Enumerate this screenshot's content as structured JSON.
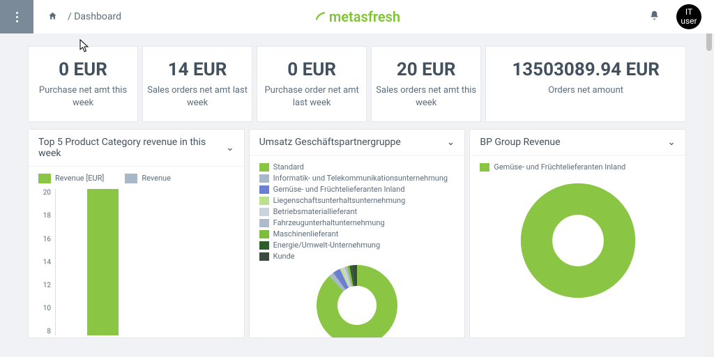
{
  "header": {
    "breadcrumb": "/ Dashboard",
    "brand": "metasfresh",
    "avatar": "IT\nuser"
  },
  "stats": [
    {
      "value": "0 EUR",
      "label": "Purchase net amt this week"
    },
    {
      "value": "14 EUR",
      "label": "Sales orders net amt last week"
    },
    {
      "value": "0 EUR",
      "label": "Purchase order net amt last week"
    },
    {
      "value": "20 EUR",
      "label": "Sales orders net amt this week"
    },
    {
      "value": "13503089.94 EUR",
      "label": "Orders net amount"
    }
  ],
  "panels": {
    "top5": {
      "title": "Top 5 Product Category revenue in this week",
      "legend1": "Revenue [EUR]",
      "legend2": "Revenue"
    },
    "umsatz": {
      "title": "Umsatz Geschäftspartnergruppe"
    },
    "bpgroup": {
      "title": "BP Group Revenue",
      "legend": "Gemüse- und Früchtelieferanten Inland"
    }
  },
  "pie_legend": [
    {
      "label": "Standard",
      "color": "#8ac644"
    },
    {
      "label": "Informatik- und Telekommunikationsunternehmung",
      "color": "#a9b8c7"
    },
    {
      "label": "Gemüse- und Früchtelieferanten Inland",
      "color": "#6b7fd0"
    },
    {
      "label": "Liegenschaftsunterhaltsunternehmung",
      "color": "#bde08e"
    },
    {
      "label": "Betriebsmateriallieferant",
      "color": "#c9d3de"
    },
    {
      "label": "Fahrzeugunterhaltunternehmung",
      "color": "#b0bcc9"
    },
    {
      "label": "Maschinenlieferant",
      "color": "#7ebd3b"
    },
    {
      "label": "Energie/Umwelt-Unternehmung",
      "color": "#2d5d2a"
    },
    {
      "label": "Kunde",
      "color": "#3a4a3d"
    }
  ],
  "chart_data": [
    {
      "type": "bar",
      "title": "Top 5 Product Category revenue in this week",
      "ylabel": "Revenue [EUR]",
      "ylim": [
        6,
        20
      ],
      "yticks": [
        20,
        18,
        16,
        14,
        12,
        10,
        8
      ],
      "categories": [
        ""
      ],
      "series": [
        {
          "name": "Revenue [EUR]",
          "color": "#8ac644",
          "values": [
            20
          ]
        },
        {
          "name": "Revenue",
          "color": "#a9b8c7",
          "values": [
            null
          ]
        }
      ]
    },
    {
      "type": "pie",
      "title": "Umsatz Geschäftspartnergruppe",
      "series": [
        {
          "name": "Standard",
          "value": 88,
          "color": "#8ac644"
        },
        {
          "name": "Informatik- und Telekommunikationsunternehmung",
          "value": 2,
          "color": "#a9b8c7"
        },
        {
          "name": "Gemüse- und Früchtelieferanten Inland",
          "value": 3,
          "color": "#6b7fd0"
        },
        {
          "name": "Liegenschaftsunterhaltsunternehmung",
          "value": 1,
          "color": "#bde08e"
        },
        {
          "name": "Betriebsmateriallieferant",
          "value": 1,
          "color": "#c9d3de"
        },
        {
          "name": "Fahrzeugunterhaltunternehmung",
          "value": 1,
          "color": "#b0bcc9"
        },
        {
          "name": "Maschinenlieferant",
          "value": 1,
          "color": "#7ebd3b"
        },
        {
          "name": "Energie/Umwelt-Unternehmung",
          "value": 1,
          "color": "#2d5d2a"
        },
        {
          "name": "Kunde",
          "value": 2,
          "color": "#3a4a3d"
        }
      ]
    },
    {
      "type": "pie",
      "title": "BP Group Revenue",
      "series": [
        {
          "name": "Gemüse- und Früchtelieferanten Inland",
          "value": 100,
          "color": "#8ac644"
        }
      ]
    }
  ]
}
